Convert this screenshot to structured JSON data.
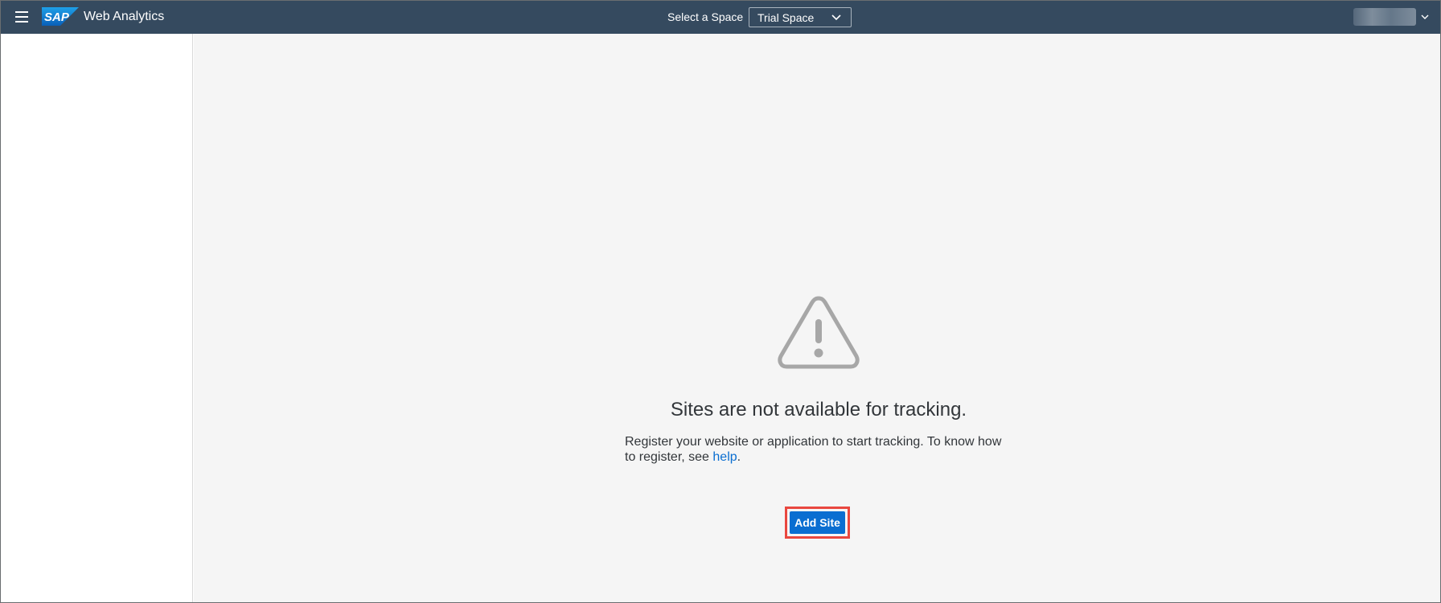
{
  "header": {
    "menu_icon": "hamburger-menu-icon",
    "logo_text": "SAP",
    "app_title": "Web Analytics",
    "space_label": "Select a Space",
    "space_value": "Trial Space",
    "space_chevron_icon": "chevron-down-icon",
    "user_chevron_icon": "chevron-down-icon",
    "colors": {
      "background": "#354a5f",
      "text": "#ffffff",
      "logo_blue": "#0a6ed1"
    }
  },
  "main": {
    "illustration_icon": "warning-triangle-icon",
    "title": "Sites are not available for tracking.",
    "description_before_link": "Register your website or application to start tracking. To know how to register, see ",
    "help_link": "help",
    "description_after_link": ".",
    "add_site_label": "Add Site",
    "colors": {
      "background": "#f5f5f5",
      "button": "#0a6ed1",
      "highlight": "#e9473f",
      "link": "#0a6ed1"
    }
  }
}
